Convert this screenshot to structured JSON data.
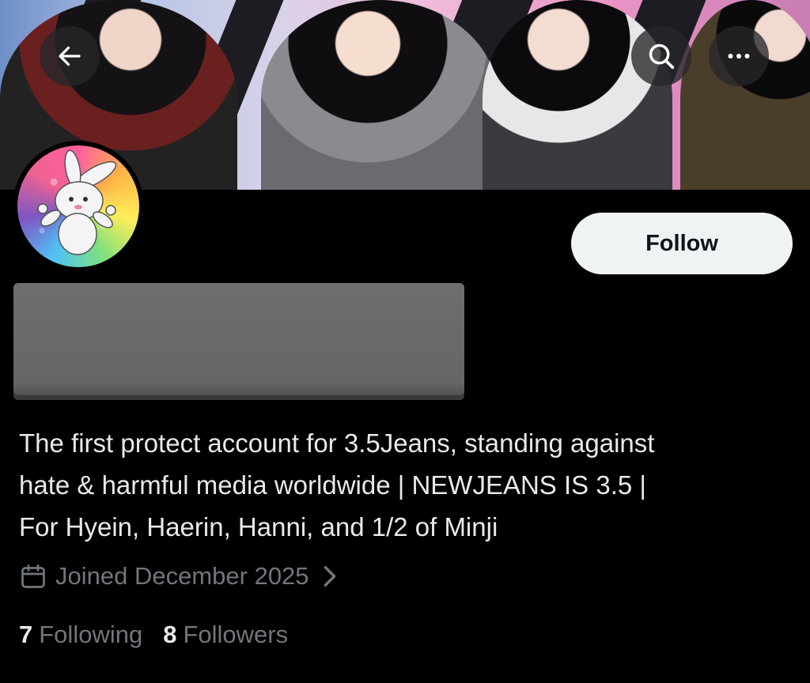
{
  "header": {
    "back_icon": "arrow-left-icon",
    "search_icon": "search-icon",
    "more_icon": "more-horizontal-icon"
  },
  "profile": {
    "follow_label": "Follow",
    "bio_lines": [
      "The first protect account for 3.5Jeans, standing against",
      "hate & harmful media worldwide | NEWJEANS IS 3.5 |",
      "For Hyein, Haerin, Hanni, and 1/2 of Minji"
    ],
    "joined": "Joined December 2025",
    "following_count": "7",
    "following_label": "Following",
    "followers_count": "8",
    "followers_label": "Followers"
  },
  "colors": {
    "background": "#000000",
    "text_primary": "#e7e9ea",
    "text_secondary": "#71767b",
    "follow_bg": "#eff3f4",
    "follow_text": "#0f1419"
  }
}
